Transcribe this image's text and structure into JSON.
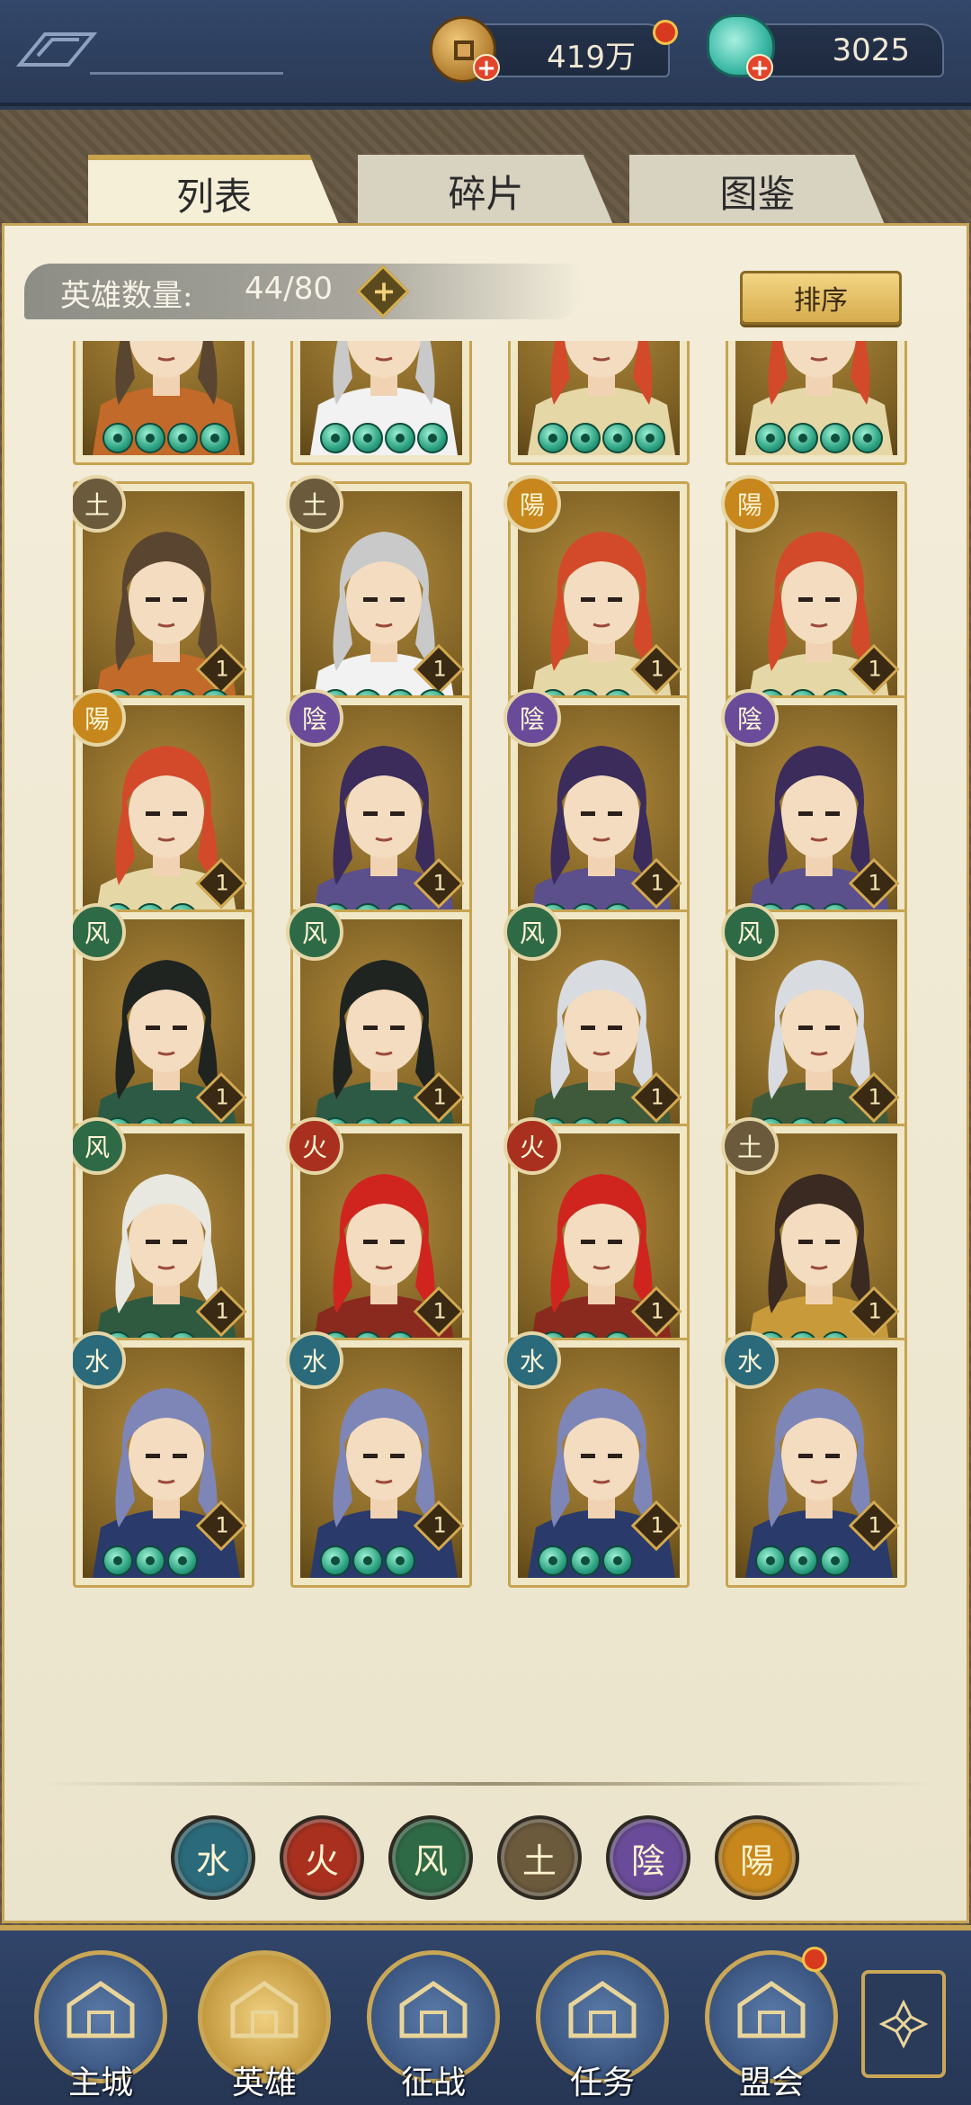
{
  "resources": {
    "copper_value": "419万",
    "jade_value": "3025"
  },
  "tabs": [
    {
      "label": "列表",
      "active": true
    },
    {
      "label": "碎片",
      "active": false
    },
    {
      "label": "图鉴",
      "active": false
    }
  ],
  "hero_count": {
    "label": "英雄数量:",
    "value": "44/80"
  },
  "sort_label": "排序",
  "elements": {
    "earth": {
      "glyph": "土",
      "color": "#6b5a3c"
    },
    "yang": {
      "glyph": "陽",
      "color": "#c8871c"
    },
    "yin": {
      "glyph": "陰",
      "color": "#6a4b9a"
    },
    "wind": {
      "glyph": "风",
      "color": "#2f6a46"
    },
    "fire": {
      "glyph": "火",
      "color": "#a9301f"
    },
    "water": {
      "glyph": "水",
      "color": "#2a6a7a"
    }
  },
  "hero_rows": [
    [
      {
        "element": "earth",
        "level": "1",
        "stars": 4,
        "hair": "#5a4630",
        "outfit": "#c26a2a"
      },
      {
        "element": "earth",
        "level": "1",
        "stars": 4,
        "hair": "#c9c9c9",
        "outfit": "#f2f2f2"
      },
      {
        "element": "yang",
        "level": "1",
        "stars": 3,
        "hair": "#d24a2a",
        "outfit": "#e6d7a6"
      },
      {
        "element": "yang",
        "level": "1",
        "stars": 3,
        "hair": "#d24a2a",
        "outfit": "#e6d7a6"
      }
    ],
    [
      {
        "element": "yang",
        "level": "1",
        "stars": 3,
        "hair": "#d24a2a",
        "outfit": "#e6d7a6"
      },
      {
        "element": "yin",
        "level": "1",
        "stars": 3,
        "hair": "#3b2c5c",
        "outfit": "#5b4f8c"
      },
      {
        "element": "yin",
        "level": "1",
        "stars": 3,
        "hair": "#3b2c5c",
        "outfit": "#5b4f8c"
      },
      {
        "element": "yin",
        "level": "1",
        "stars": 3,
        "hair": "#3b2c5c",
        "outfit": "#5b4f8c"
      }
    ],
    [
      {
        "element": "wind",
        "level": "1",
        "stars": 3,
        "hair": "#1f2420",
        "outfit": "#2d5a45"
      },
      {
        "element": "wind",
        "level": "1",
        "stars": 3,
        "hair": "#1f2420",
        "outfit": "#2d5a45"
      },
      {
        "element": "wind",
        "level": "1",
        "stars": 3,
        "hair": "#d8dbe0",
        "outfit": "#3f5a3a"
      },
      {
        "element": "wind",
        "level": "1",
        "stars": 3,
        "hair": "#d8dbe0",
        "outfit": "#3f5a3a"
      }
    ],
    [
      {
        "element": "wind",
        "level": "1",
        "stars": 3,
        "hair": "#e8e8e0",
        "outfit": "#2f5a40"
      },
      {
        "element": "fire",
        "level": "1",
        "stars": 3,
        "hair": "#d0251f",
        "outfit": "#8a2a1e"
      },
      {
        "element": "fire",
        "level": "1",
        "stars": 3,
        "hair": "#d0251f",
        "outfit": "#8a2a1e"
      },
      {
        "element": "earth",
        "level": "1",
        "stars": 3,
        "hair": "#3a2a22",
        "outfit": "#c89a3a"
      }
    ],
    [
      {
        "element": "water",
        "level": "1",
        "stars": 3,
        "hair": "#7e86b8",
        "outfit": "#2a3a6a"
      },
      {
        "element": "water",
        "level": "1",
        "stars": 3,
        "hair": "#7e86b8",
        "outfit": "#2a3a6a"
      },
      {
        "element": "water",
        "level": "1",
        "stars": 3,
        "hair": "#7e86b8",
        "outfit": "#2a3a6a"
      },
      {
        "element": "water",
        "level": "1",
        "stars": 3,
        "hair": "#7e86b8",
        "outfit": "#2a3a6a"
      }
    ]
  ],
  "filters": [
    "water",
    "fire",
    "wind",
    "earth",
    "yin",
    "yang"
  ],
  "nav": [
    {
      "label": "主城",
      "icon": "city-gate-icon",
      "active": false,
      "dot": false
    },
    {
      "label": "英雄",
      "icon": "hero-portrait-icon",
      "active": true,
      "dot": false
    },
    {
      "label": "征战",
      "icon": "battle-icon",
      "active": false,
      "dot": false
    },
    {
      "label": "任务",
      "icon": "scroll-icon",
      "active": false,
      "dot": false
    },
    {
      "label": "盟会",
      "icon": "pavilion-icon",
      "active": false,
      "dot": true
    }
  ],
  "more_icon": "flower-menu-icon"
}
